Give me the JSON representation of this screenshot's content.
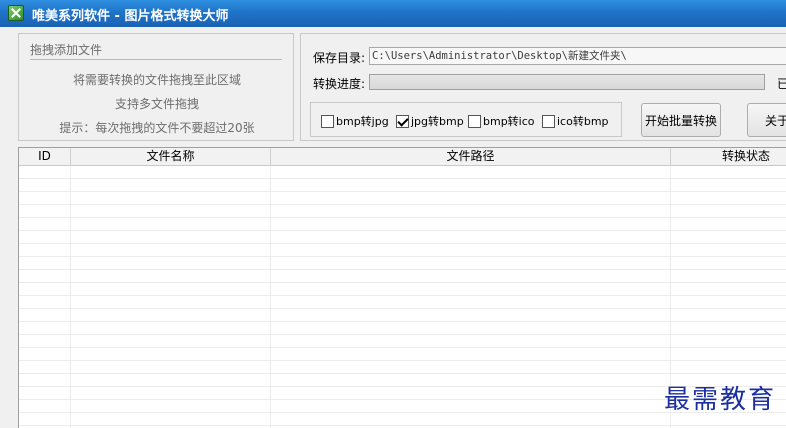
{
  "window": {
    "title": "唯美系列软件 - 图片格式转换大师"
  },
  "drop_area": {
    "title": "拖拽添加文件",
    "line1": "将需要转换的文件拖拽至此区域",
    "line2": "支持多文件拖拽",
    "hint": "提示：每次拖拽的文件不要超过20张"
  },
  "settings": {
    "save_dir_label": "保存目录:",
    "save_dir_value": "C:\\Users\\Administrator\\Desktop\\新建文件夹\\",
    "progress_label": "转换进度:",
    "progress_value": 0,
    "progress_text": "已"
  },
  "options": [
    {
      "label": "bmp转jpg",
      "checked": false
    },
    {
      "label": "jpg转bmp",
      "checked": true
    },
    {
      "label": "bmp转ico",
      "checked": false
    },
    {
      "label": "ico转bmp",
      "checked": false
    }
  ],
  "buttons": {
    "start": "开始批量转换",
    "about": "关于"
  },
  "table": {
    "columns": [
      "ID",
      "文件名称",
      "文件路径",
      "转换状态"
    ],
    "rows": []
  },
  "watermark": "最需教育",
  "colors": {
    "titlebar": "#1f73c8",
    "progress_fill": "#35b535",
    "watermark": "#1b2f9e"
  }
}
